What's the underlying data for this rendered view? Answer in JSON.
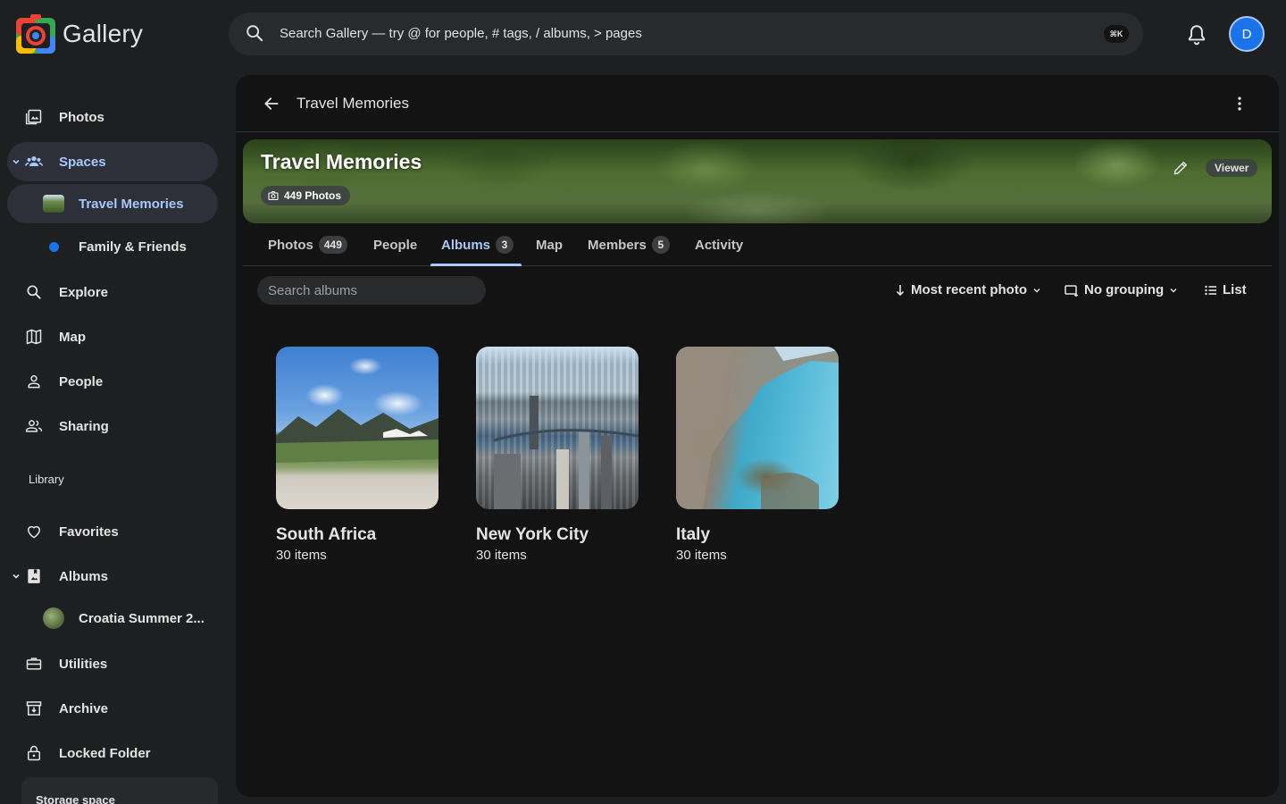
{
  "app": {
    "name": "Gallery"
  },
  "search": {
    "placeholder": "Search Gallery — try @ for people, # tags, / albums, > pages",
    "shortcut": "⌘K"
  },
  "user": {
    "initial": "D"
  },
  "sidebar": {
    "items": [
      {
        "label": "Photos"
      },
      {
        "label": "Spaces"
      },
      {
        "label": "Travel Memories"
      },
      {
        "label": "Family & Friends"
      },
      {
        "label": "Explore"
      },
      {
        "label": "Map"
      },
      {
        "label": "People"
      },
      {
        "label": "Sharing"
      }
    ],
    "library_label": "Library",
    "library_items": [
      {
        "label": "Favorites"
      },
      {
        "label": "Albums"
      },
      {
        "label": "Croatia Summer 2..."
      },
      {
        "label": "Utilities"
      },
      {
        "label": "Archive"
      },
      {
        "label": "Locked Folder"
      }
    ],
    "storage_label": "Storage space"
  },
  "space": {
    "header_title": "Travel Memories",
    "banner_title": "Travel Memories",
    "photo_count_label": "449 Photos",
    "role": "Viewer"
  },
  "tabs": [
    {
      "label": "Photos",
      "badge": "449"
    },
    {
      "label": "People",
      "badge": ""
    },
    {
      "label": "Albums",
      "badge": "3"
    },
    {
      "label": "Map",
      "badge": ""
    },
    {
      "label": "Members",
      "badge": "5"
    },
    {
      "label": "Activity",
      "badge": ""
    }
  ],
  "toolbar": {
    "search_placeholder": "Search albums",
    "sort_label": "Most recent photo",
    "group_label": "No grouping",
    "view_label": "List"
  },
  "albums": [
    {
      "name": "South Africa",
      "count": "30 items"
    },
    {
      "name": "New York City",
      "count": "30 items"
    },
    {
      "name": "Italy",
      "count": "30 items"
    }
  ],
  "colors": {
    "accent": "#a8c7fa",
    "background": "#1e1f20",
    "panel": "#131314",
    "avatar": "#1a73e8",
    "space_dot": "#1a73e8"
  }
}
